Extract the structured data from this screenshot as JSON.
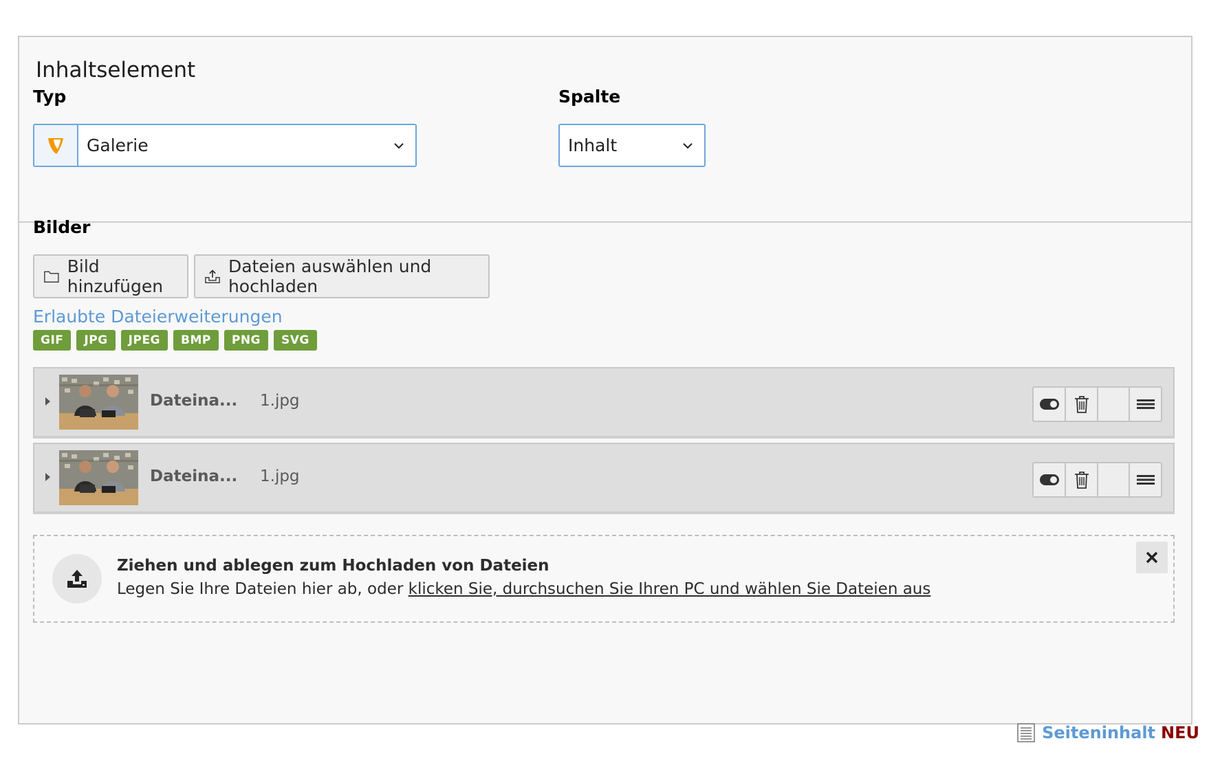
{
  "section": {
    "title": "Inhaltselement"
  },
  "type_field": {
    "label": "Typ",
    "value": "Galerie",
    "icon": "typo3-icon"
  },
  "column_field": {
    "label": "Spalte",
    "value": "Inhalt"
  },
  "images": {
    "label": "Bilder",
    "add_button": "Bild hinzufügen",
    "upload_button": "Dateien auswählen und hochladen",
    "allowed_link": "Erlaubte Dateierweiterungen",
    "extensions": [
      "GIF",
      "JPG",
      "JPEG",
      "BMP",
      "PNG",
      "SVG"
    ],
    "files": [
      {
        "name_label": "Dateina...",
        "name_value": "1.jpg"
      },
      {
        "name_label": "Dateina...",
        "name_value": "1.jpg"
      }
    ]
  },
  "dropzone": {
    "title": "Ziehen und ablegen zum Hochladen von Dateien",
    "text_prefix": "Legen Sie Ihre Dateien hier ab, oder ",
    "link": "klicken Sie, durchsuchen Sie Ihren PC und wählen Sie Dateien aus"
  },
  "footer": {
    "label": "Seiteninhalt",
    "badge": "NEU"
  },
  "colors": {
    "accent": "#6fa6db",
    "link": "#5d9ad4",
    "badge": "#6f9d3c",
    "typo3": "#f49700",
    "new": "#8b0000"
  }
}
